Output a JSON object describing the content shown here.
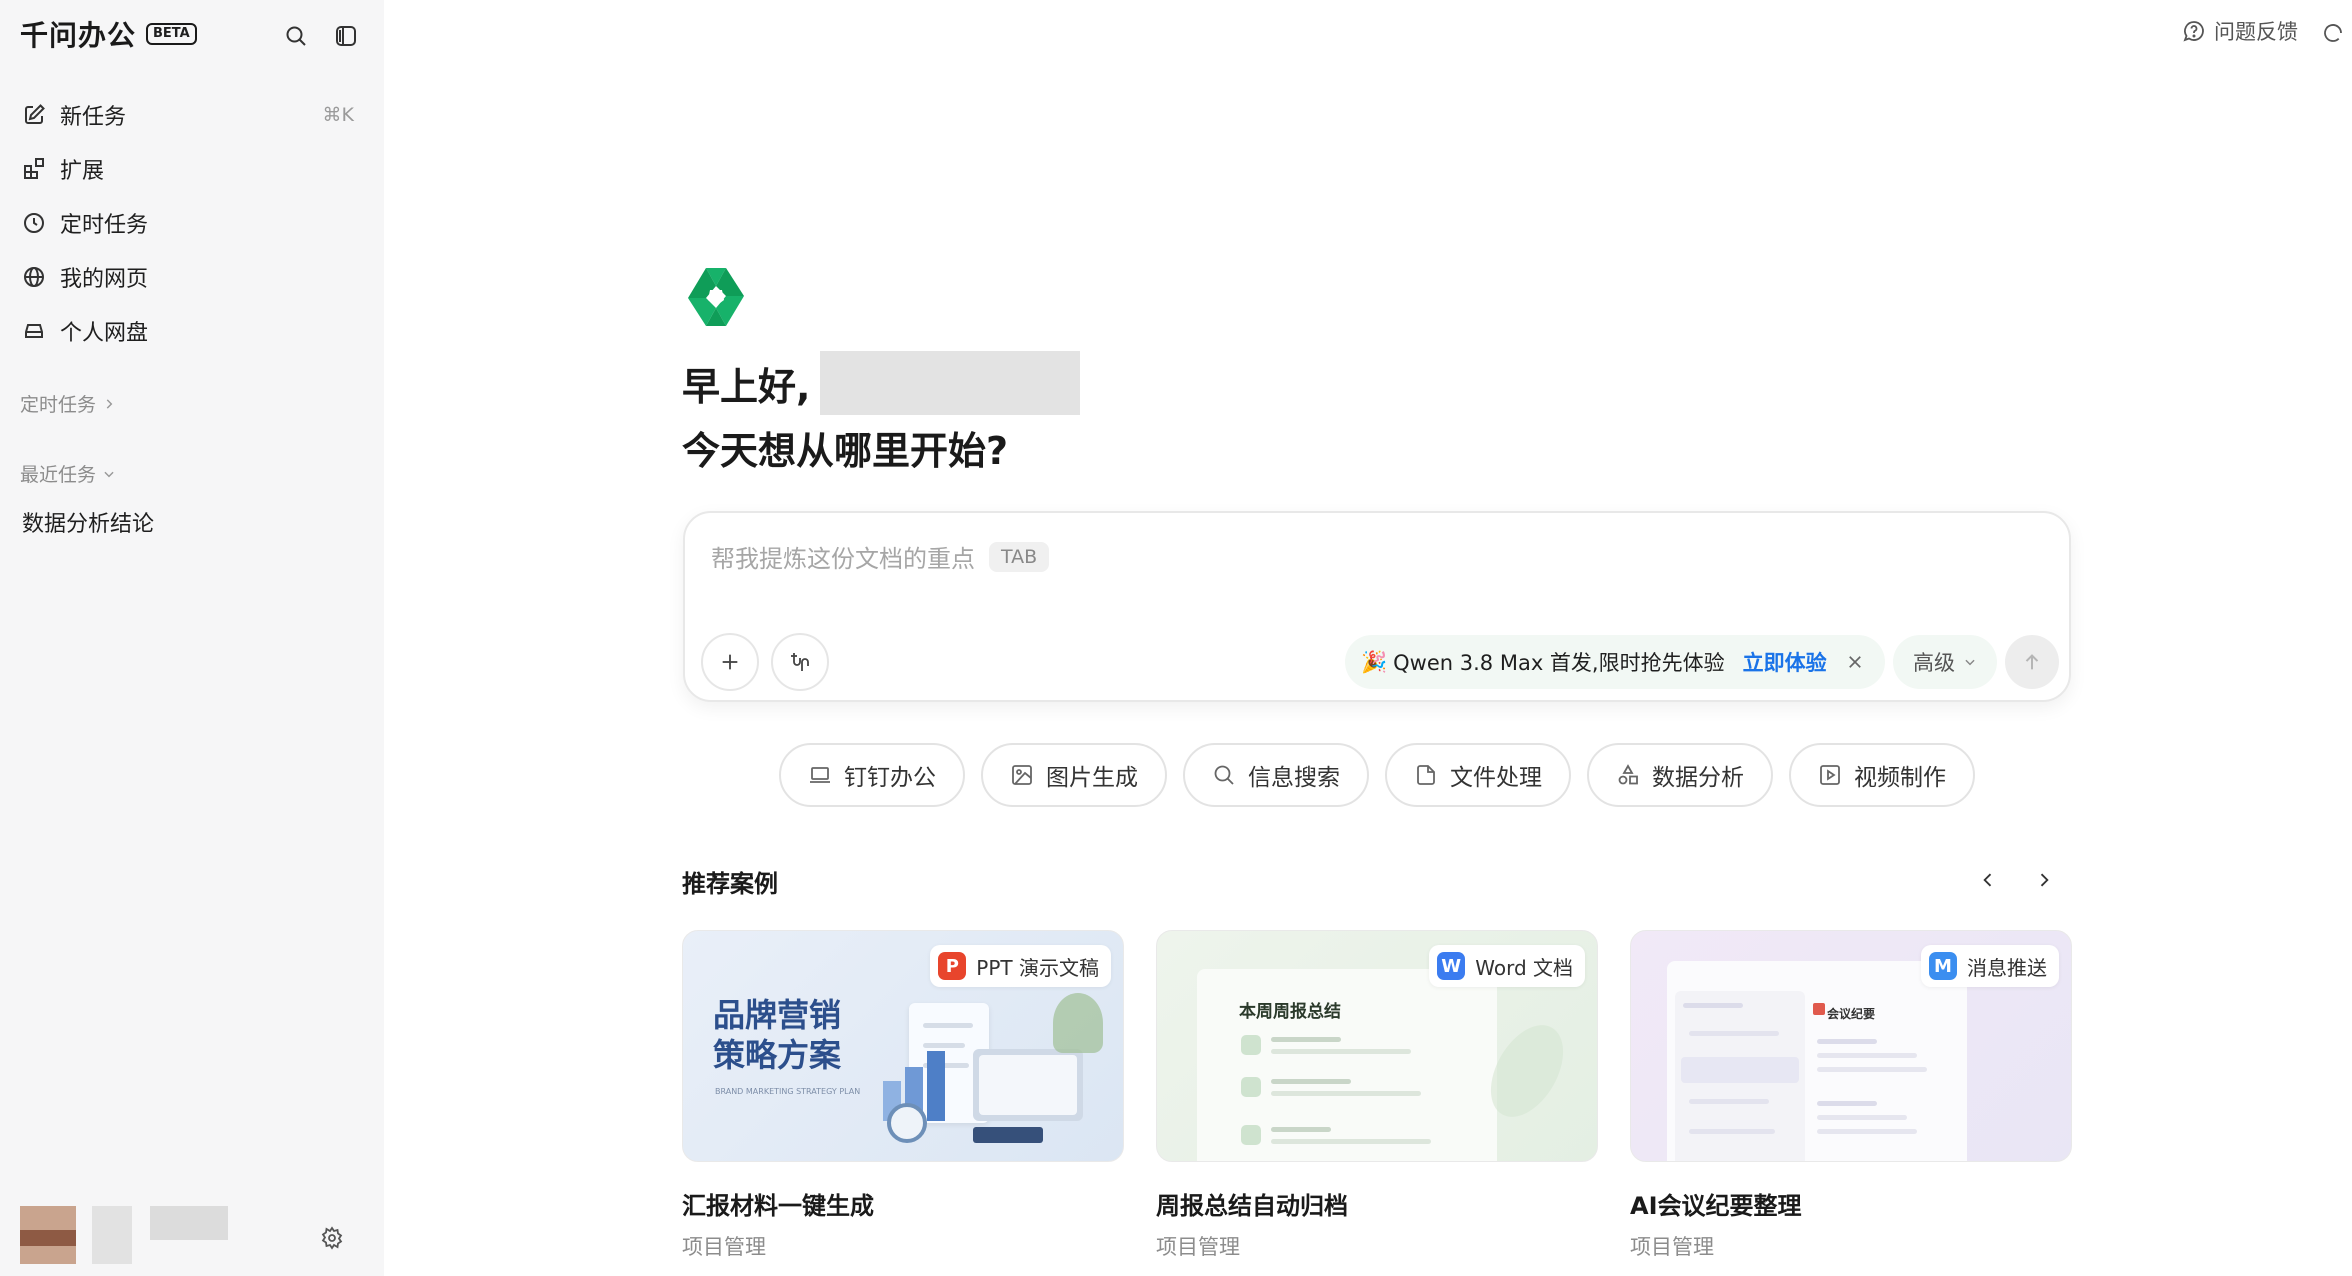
{
  "app": {
    "brand": "千问办公",
    "beta_badge": "BETA"
  },
  "sidebar": {
    "nav_items": [
      {
        "label": "新任务",
        "icon": "edit-icon",
        "shortcut": "⌘K"
      },
      {
        "label": "扩展",
        "icon": "extensions-icon"
      },
      {
        "label": "定时任务",
        "icon": "clock-icon"
      },
      {
        "label": "我的网页",
        "icon": "globe-icon"
      },
      {
        "label": "个人网盘",
        "icon": "drive-icon"
      }
    ],
    "scheduled_section": "定时任务",
    "recent_section": "最近任务",
    "recent_items": [
      "数据分析结论"
    ]
  },
  "header": {
    "feedback_label": "问题反馈"
  },
  "main": {
    "greeting": "早上好,",
    "subgreeting": "今天想从哪里开始?",
    "composer": {
      "placeholder": "帮我提炼这份文档的重点",
      "tab_hint": "TAB",
      "promo_emoji": "🎉",
      "promo_text": "Qwen 3.8 Max 首发,限时抢先体验",
      "promo_cta": "立即体验",
      "level_label": "高级"
    },
    "chips": [
      {
        "label": "钉钉办公",
        "icon": "laptop-icon"
      },
      {
        "label": "图片生成",
        "icon": "image-icon"
      },
      {
        "label": "信息搜索",
        "icon": "search-icon"
      },
      {
        "label": "文件处理",
        "icon": "file-icon"
      },
      {
        "label": "数据分析",
        "icon": "shapes-icon"
      },
      {
        "label": "视频制作",
        "icon": "play-icon"
      }
    ],
    "recommend_title": "推荐案例",
    "cards": [
      {
        "badge_letter": "P",
        "badge_label": "PPT 演示文稿",
        "badge_color": "#e8452c",
        "thumb_line1": "品牌营销",
        "thumb_line2": "策略方案",
        "thumb_small": "BRAND MARKETING STRATEGY PLAN",
        "title": "汇报材料一键生成",
        "subtitle": "项目管理"
      },
      {
        "badge_letter": "W",
        "badge_label": "Word 文档",
        "badge_color": "#3b7cf0",
        "thumb_title": "本周周报总结",
        "title": "周报总结自动归档",
        "subtitle": "项目管理"
      },
      {
        "badge_letter": "M",
        "badge_label": "消息推送",
        "badge_color": "#3b8ef0",
        "thumb_title": "会议纪要",
        "title": "AI会议纪要整理",
        "subtitle": "项目管理"
      }
    ]
  }
}
